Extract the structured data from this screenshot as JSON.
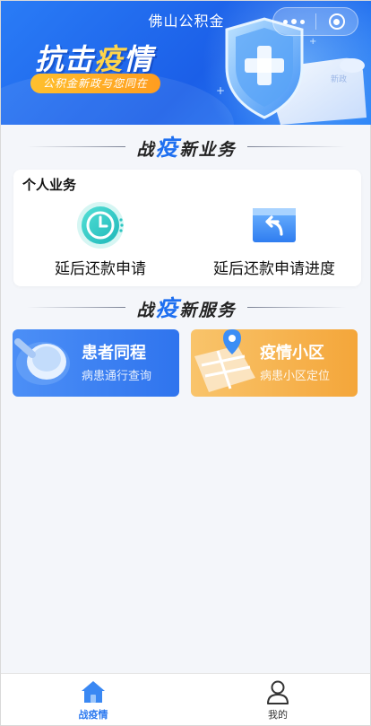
{
  "header": {
    "title": "佛山公积金",
    "headline_part1": "抗击",
    "headline_highlight": "疫",
    "headline_part2": "情",
    "slogan": "公积金新政与您同在",
    "scroll_label": "新政"
  },
  "section_business": {
    "pre": "战",
    "big": "疫",
    "post": "新业务"
  },
  "personal": {
    "title": "个人业务",
    "items": [
      {
        "label": "延后还款申请",
        "icon": "clock-icon"
      },
      {
        "label": "延后还款申请进度",
        "icon": "return-card-icon"
      }
    ]
  },
  "section_service": {
    "pre": "战",
    "big": "疫",
    "post": "新服务"
  },
  "services": [
    {
      "title": "患者同程",
      "subtitle": "病患通行查询",
      "icon": "magnifier-icon"
    },
    {
      "title": "疫情小区",
      "subtitle": "病患小区定位",
      "icon": "map-pin-icon"
    }
  ],
  "tabbar": [
    {
      "label": "战疫情",
      "icon": "home-icon",
      "active": true
    },
    {
      "label": "我的",
      "icon": "person-icon",
      "active": false
    }
  ],
  "colors": {
    "primary": "#2e7bf0",
    "accent_yellow": "#ffd54a",
    "tile_orange": "#f4a63a"
  }
}
